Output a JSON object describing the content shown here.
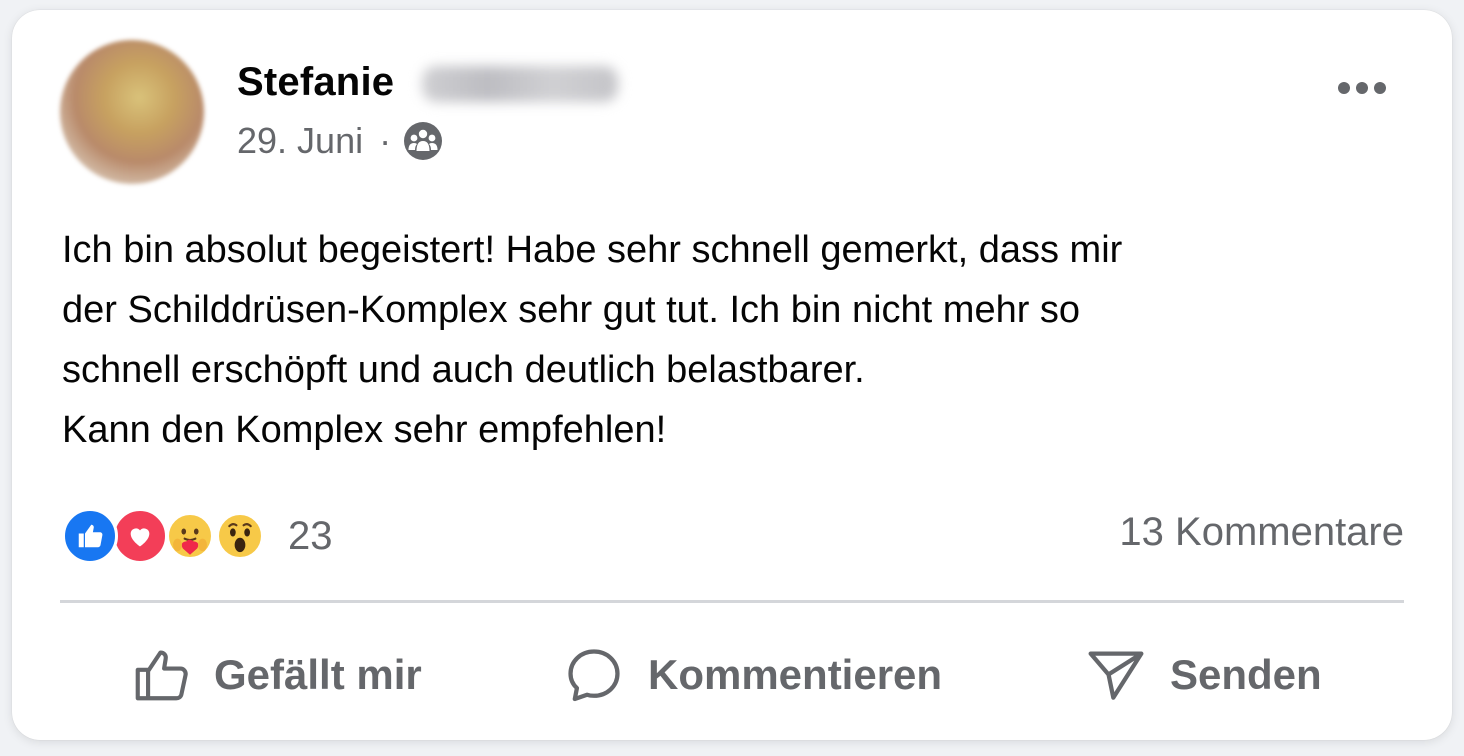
{
  "post": {
    "author_first_name": "Stefanie",
    "date": "29. Juni",
    "separator": "·",
    "audience_icon": "group-audience-icon",
    "body_lines": [
      "Ich bin absolut begeistert! Habe sehr schnell gemerkt, dass mir",
      "der Schilddrüsen-Komplex sehr gut tut. Ich bin nicht mehr so",
      "schnell erschöpft und auch deutlich belastbarer.",
      "Kann den Komplex sehr empfehlen!"
    ]
  },
  "reactions": {
    "icons": [
      "like-reaction-icon",
      "love-reaction-icon",
      "care-reaction-icon",
      "wow-reaction-icon"
    ],
    "count": "23",
    "comments_label": "13 Kommentare"
  },
  "actions": {
    "like_label": "Gefällt mir",
    "comment_label": "Kommentieren",
    "send_label": "Senden"
  },
  "colors": {
    "like_blue": "#1877f2",
    "love_red": "#f33e58",
    "secondary_text": "#65676b",
    "primary_text": "#050505"
  }
}
